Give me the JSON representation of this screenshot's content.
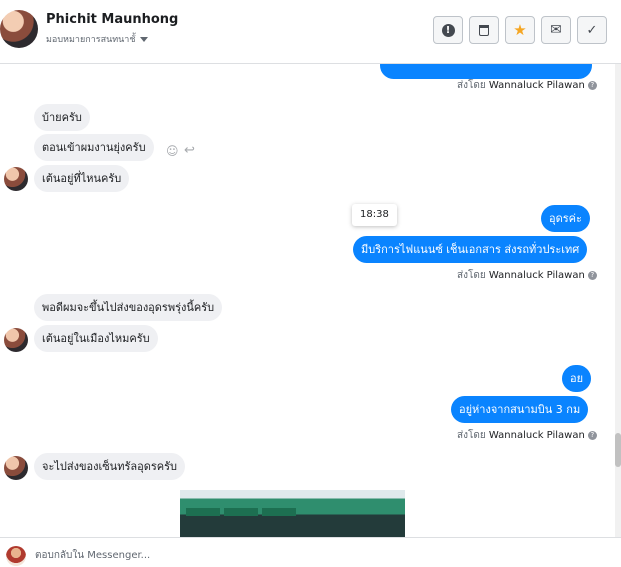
{
  "header": {
    "contact_name": "Phichit Maunhong",
    "contact_subtitle": "มอบหมายการสนทนาชั้"
  },
  "toolbar": [
    {
      "name": "report-button",
      "icon": "alert-icon",
      "glyph": "!"
    },
    {
      "name": "delete-button",
      "icon": "trash-icon",
      "glyph": "🗑"
    },
    {
      "name": "star-button",
      "icon": "star-icon",
      "glyph": "★",
      "color": "#f5a623"
    },
    {
      "name": "mail-button",
      "icon": "envelope-icon",
      "glyph": "✉"
    },
    {
      "name": "done-button",
      "icon": "check-icon",
      "glyph": "✓"
    }
  ],
  "messages": {
    "in1": "บ้ายครับ",
    "in2": "ตอนเข้าผมงานยุ่งครับ",
    "in3": "เต้นอยู่ที่ไหนครับ",
    "out1": "อุดรค่ะ",
    "out2": "มีบริการไฟแนนซ์ เช็นเอกสาร ส่งรถทั่วประเทศ",
    "in4": "พอดีผมจะขึ้นไปส่งของอุดรพรุ่งนี้ครับ",
    "in5": "เต้นอยู่ในเมืองไหมครับ",
    "out3": "อย",
    "out4": "อยู่ห่างจากสนามบิน 3 กม",
    "in6": "จะไปส่งของเซ็นทรัลอุดรครับ"
  },
  "time_chip": "18:38",
  "sent_by": {
    "prefix": "ส่งโดย",
    "name": "Wannaluck Pilawan"
  },
  "composer": {
    "placeholder": "ตอบกลับใน Messenger..."
  },
  "colors": {
    "outgoing_bubble": "#0a84ff",
    "incoming_bubble": "#eff0f3",
    "star": "#f5a623"
  }
}
